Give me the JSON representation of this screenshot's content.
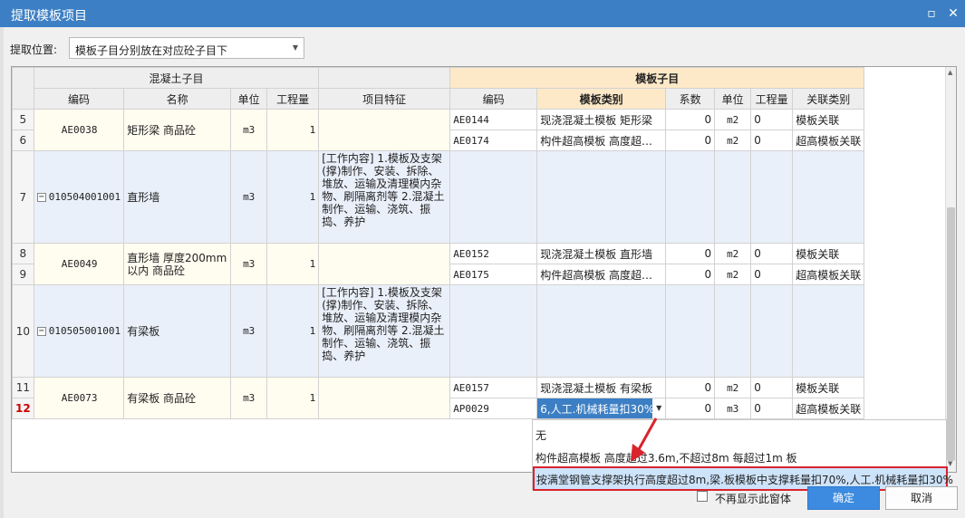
{
  "window": {
    "title": "提取模板项目"
  },
  "position": {
    "label": "提取位置:",
    "value": "模板子目分别放在对应砼子目下"
  },
  "table": {
    "groups": {
      "left": "混凝土子目",
      "right": "模板子目"
    },
    "headers": {
      "code": "编码",
      "name": "名称",
      "unit": "单位",
      "qty": "工程量",
      "feature": "项目特征",
      "tcode": "编码",
      "ttype": "模板类别",
      "coef": "系数",
      "tunit": "单位",
      "tqty": "工程量",
      "rel": "关联类别"
    },
    "rows": [
      {
        "n": "5",
        "tcode": "AE0144",
        "ttype": "现浇混凝土模板 矩形梁",
        "coef": "0",
        "tunit": "m2",
        "tqty": "0",
        "rel": "模板关联"
      },
      {
        "n": "6",
        "tcode": "AE0174",
        "ttype": "构件超高模板 高度超…",
        "coef": "0",
        "tunit": "m2",
        "tqty": "0",
        "rel": "超高模板关联"
      },
      {
        "n": "7",
        "code": "010504001001",
        "name": "直形墙",
        "unit": "m3",
        "qty": "1",
        "feature": "[工作内容]\n1.模板及支架(撑)制作、安装、拆除、堆放、运输及清理模内杂物、刷隔离剂等\n2.混凝土制作、运输、浇筑、振捣、养护"
      },
      {
        "n": "8",
        "tcode": "AE0152",
        "ttype": "现浇混凝土模板 直形墙",
        "coef": "0",
        "tunit": "m2",
        "tqty": "0",
        "rel": "模板关联"
      },
      {
        "n": "9",
        "tcode": "AE0175",
        "ttype": "构件超高模板 高度超…",
        "coef": "0",
        "tunit": "m2",
        "tqty": "0",
        "rel": "超高模板关联"
      },
      {
        "n": "10",
        "code": "010505001001",
        "name": "有梁板",
        "unit": "m3",
        "qty": "1",
        "feature": "[工作内容]\n1.模板及支架(撑)制作、安装、拆除、堆放、运输及清理模内杂物、刷隔离剂等\n2.混凝土制作、运输、浇筑、振捣、养护"
      },
      {
        "n": "11",
        "tcode": "AE0157",
        "ttype": "现浇混凝土模板 有梁板",
        "coef": "0",
        "tunit": "m2",
        "tqty": "0",
        "rel": "模板关联"
      },
      {
        "n": "12",
        "tcode": "AP0029",
        "ttype": "6,人工.机械耗量扣30%",
        "coef": "0",
        "tunit": "m3",
        "tqty": "0",
        "rel": "超高模板关联"
      }
    ],
    "merged": [
      {
        "code": "AE0038",
        "name": "矩形梁 商品砼",
        "unit": "m3",
        "qty": "1"
      },
      {
        "code": "AE0049",
        "name": "直形墙 厚度200mm以内 商品砼",
        "unit": "m3",
        "qty": "1"
      },
      {
        "code": "AE0073",
        "name": "有梁板 商品砼",
        "unit": "m3",
        "qty": "1"
      }
    ]
  },
  "dropdown": {
    "options": [
      "无",
      "构件超高模板 高度超过3.6m,不超过8m 每超过1m 板",
      "按满堂钢管支撑架执行高度超过8m,梁.板模板中支撑耗量扣70%,人工.机械耗量扣30%"
    ]
  },
  "footer": {
    "nodisplay": "不再显示此窗体",
    "ok": "确定",
    "cancel": "取消"
  }
}
